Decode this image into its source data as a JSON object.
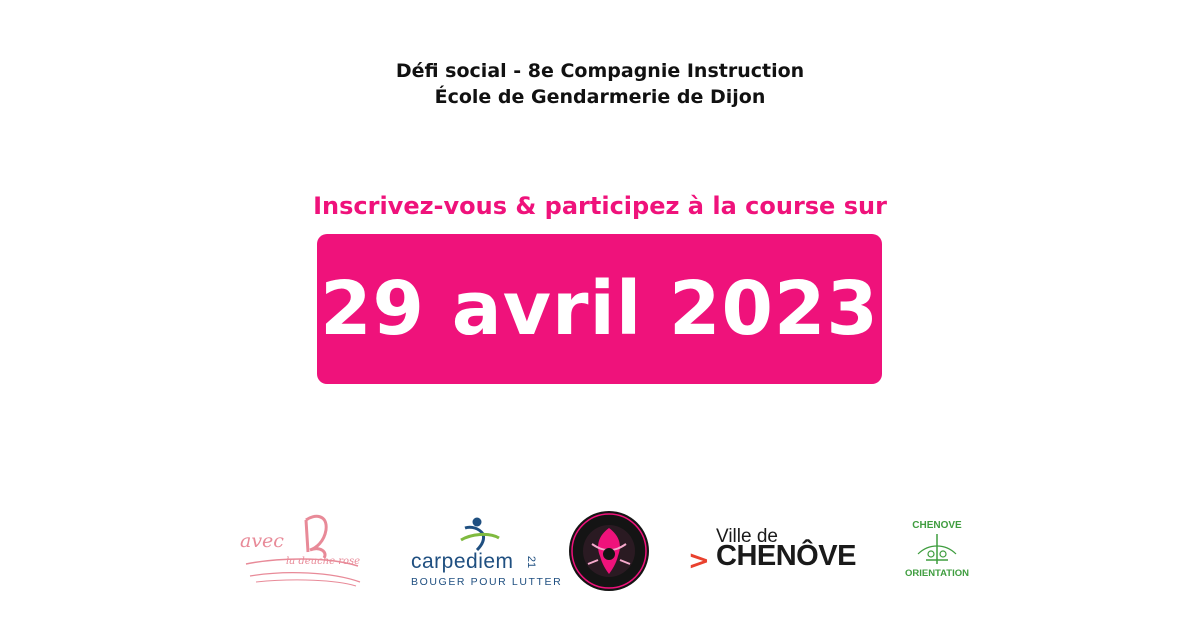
{
  "header": {
    "line1": "Défi social - 8e Compagnie Instruction",
    "line2": "École de Gendarmerie de Dijon"
  },
  "cta": {
    "text": "Inscrivez-vous & participez à la course sur"
  },
  "event": {
    "date": "29 avril 2023"
  },
  "partners": {
    "avec": {
      "main": "avec",
      "sub": "la deuche rose"
    },
    "carpediem": {
      "name": "carpediem",
      "num": "21",
      "tagline": "BOUGER POUR LUTTER"
    },
    "badge": {
      "icon": "pink-badge-logo"
    },
    "ville": {
      "prefix": "Ville de",
      "name": "CHENÔVE",
      "arrow": ">"
    },
    "orientation": {
      "top": "CHENOVE",
      "bottom": "ORIENTATION",
      "mark": "AOC"
    }
  },
  "colors": {
    "accent": "#ef127b",
    "header_text": "#111111",
    "date_text": "#ffffff",
    "avec_pink": "#e88a98",
    "carpe_blue": "#1f4f80",
    "carpe_green": "#7fba3f",
    "orient_green": "#3f9d3f",
    "ville_red": "#e9412e"
  }
}
